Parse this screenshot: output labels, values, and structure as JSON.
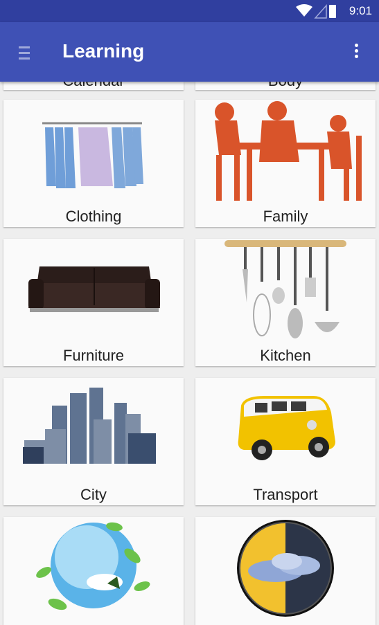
{
  "status_bar": {
    "time": "9:01"
  },
  "app_bar": {
    "title": "Learning"
  },
  "categories": [
    {
      "label": "Calendar",
      "icon": "calendar-icon"
    },
    {
      "label": "Body",
      "icon": "body-icon"
    },
    {
      "label": "Clothing",
      "icon": "shirts-on-rack-icon"
    },
    {
      "label": "Family",
      "icon": "family-at-table-icon"
    },
    {
      "label": "Furniture",
      "icon": "sofa-icon"
    },
    {
      "label": "Kitchen",
      "icon": "kitchen-utensils-icon"
    },
    {
      "label": "City",
      "icon": "city-skyline-icon"
    },
    {
      "label": "Transport",
      "icon": "van-icon"
    },
    {
      "label": "",
      "icon": "globe-nature-icon"
    },
    {
      "label": "",
      "icon": "weather-icon"
    }
  ]
}
